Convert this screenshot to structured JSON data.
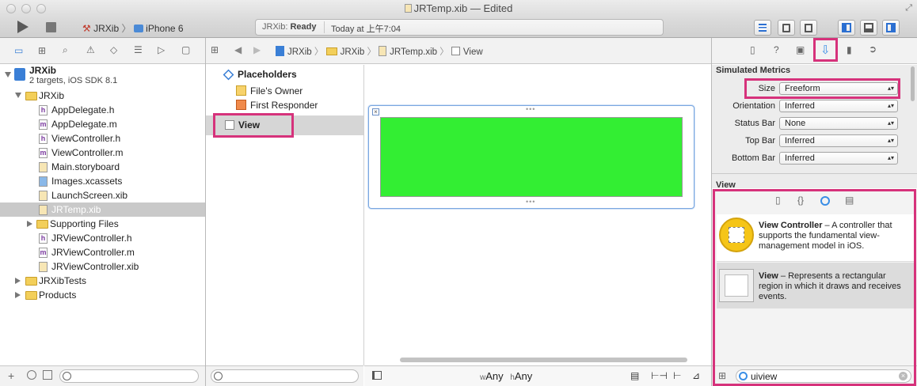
{
  "window": {
    "title": "JRTemp.xib — Edited"
  },
  "toolbar": {
    "scheme": "JRXib",
    "device": "iPhone 6",
    "status_app": "JRXib:",
    "status_state": "Ready",
    "status_time": "Today at 上午7:04"
  },
  "jumpbar": {
    "crumbs": [
      "JRXib",
      "JRXib",
      "JRTemp.xib",
      "View"
    ]
  },
  "navigator": {
    "project": {
      "name": "JRXib",
      "subtitle": "2 targets, iOS SDK 8.1"
    },
    "items": [
      {
        "label": "JRXib",
        "kind": "folder"
      },
      {
        "label": "AppDelegate.h",
        "kind": "h"
      },
      {
        "label": "AppDelegate.m",
        "kind": "m"
      },
      {
        "label": "ViewController.h",
        "kind": "h"
      },
      {
        "label": "ViewController.m",
        "kind": "m"
      },
      {
        "label": "Main.storyboard",
        "kind": "sb"
      },
      {
        "label": "Images.xcassets",
        "kind": "assets"
      },
      {
        "label": "LaunchScreen.xib",
        "kind": "xib"
      },
      {
        "label": "JRTemp.xib",
        "kind": "xib"
      },
      {
        "label": "Supporting Files",
        "kind": "folder"
      },
      {
        "label": "JRViewController.h",
        "kind": "h"
      },
      {
        "label": "JRViewController.m",
        "kind": "m"
      },
      {
        "label": "JRViewController.xib",
        "kind": "xib"
      },
      {
        "label": "JRXibTests",
        "kind": "folder"
      },
      {
        "label": "Products",
        "kind": "folder"
      }
    ]
  },
  "outline": {
    "placeholders": "Placeholders",
    "files_owner": "File's Owner",
    "first_responder": "First Responder",
    "view": "View"
  },
  "canvas": {
    "view_color": "#33ee33",
    "size_any_w": "Any",
    "size_any_h": "Any",
    "w": "w",
    "h": "h"
  },
  "inspector": {
    "section_title": "Simulated Metrics",
    "size_label": "Size",
    "size_value": "Freeform",
    "orientation_label": "Orientation",
    "orientation_value": "Inferred",
    "statusbar_label": "Status Bar",
    "statusbar_value": "None",
    "topbar_label": "Top Bar",
    "topbar_value": "Inferred",
    "bottombar_label": "Bottom Bar",
    "bottombar_value": "Inferred",
    "view_section": "View"
  },
  "library": {
    "items": [
      {
        "title": "View Controller",
        "desc": " – A controller that supports the fundamental view-management model in iOS."
      },
      {
        "title": "View",
        "desc": " – Represents a rectangular region in which it draws and receives events."
      }
    ],
    "search_value": "uiview"
  },
  "colors": {
    "highlight": "#d6327b",
    "selection": "#d4d4d4",
    "accent": "#3a8ee6"
  }
}
